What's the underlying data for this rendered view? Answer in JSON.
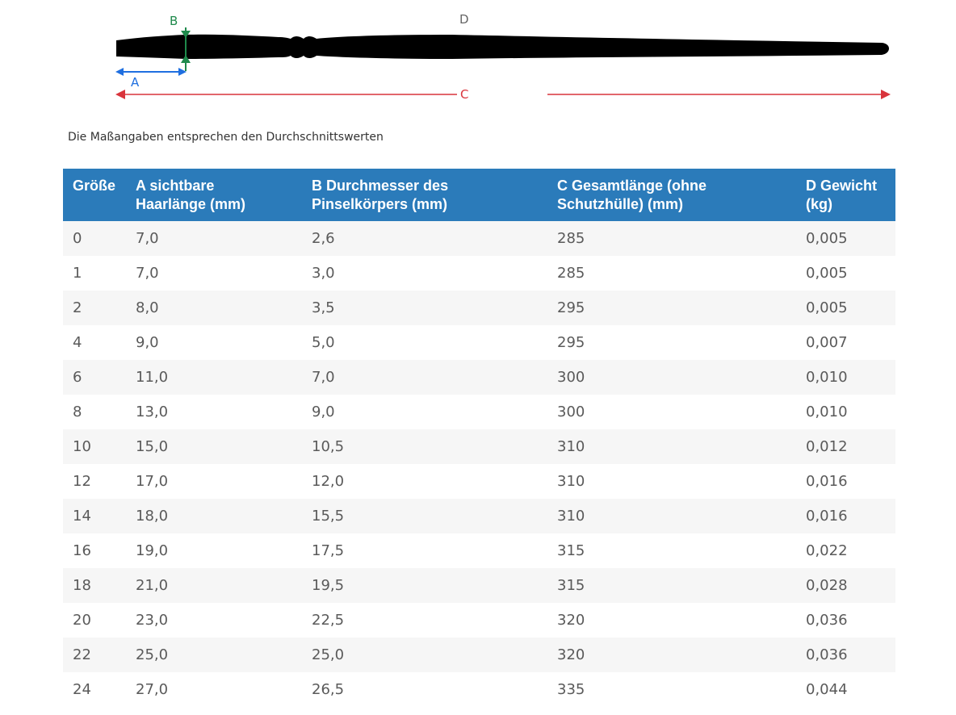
{
  "diagram": {
    "labels": {
      "a": "A",
      "b": "B",
      "c": "C",
      "d": "D"
    },
    "colors": {
      "a": "#1f6fe0",
      "b": "#1f8a4c",
      "c": "#d9343c",
      "d": "#666666",
      "brush": "#000000"
    }
  },
  "note": "Die Maßangaben entsprechen den Durchschnittswerten",
  "table": {
    "header_color": "#2b7bba",
    "columns": [
      {
        "line1": "Größe",
        "line2": ""
      },
      {
        "line1": "A sichtbare",
        "line2": "Haarlänge (mm)"
      },
      {
        "line1": "B Durchmesser des",
        "line2": "Pinselkörpers (mm)"
      },
      {
        "line1": "C Gesamtlänge (ohne",
        "line2": "Schutzhülle) (mm)"
      },
      {
        "line1": "D Gewicht",
        "line2": "(kg)"
      }
    ],
    "rows": [
      [
        "0",
        "7,0",
        "2,6",
        "285",
        "0,005"
      ],
      [
        "1",
        "7,0",
        "3,0",
        "285",
        "0,005"
      ],
      [
        "2",
        "8,0",
        "3,5",
        "295",
        "0,005"
      ],
      [
        "4",
        "9,0",
        "5,0",
        "295",
        "0,007"
      ],
      [
        "6",
        "11,0",
        "7,0",
        "300",
        "0,010"
      ],
      [
        "8",
        "13,0",
        "9,0",
        "300",
        "0,010"
      ],
      [
        "10",
        "15,0",
        "10,5",
        "310",
        "0,012"
      ],
      [
        "12",
        "17,0",
        "12,0",
        "310",
        "0,016"
      ],
      [
        "14",
        "18,0",
        "15,5",
        "310",
        "0,016"
      ],
      [
        "16",
        "19,0",
        "17,5",
        "315",
        "0,022"
      ],
      [
        "18",
        "21,0",
        "19,5",
        "315",
        "0,028"
      ],
      [
        "20",
        "23,0",
        "22,5",
        "320",
        "0,036"
      ],
      [
        "22",
        "25,0",
        "25,0",
        "320",
        "0,036"
      ],
      [
        "24",
        "27,0",
        "26,5",
        "335",
        "0,044"
      ]
    ]
  }
}
